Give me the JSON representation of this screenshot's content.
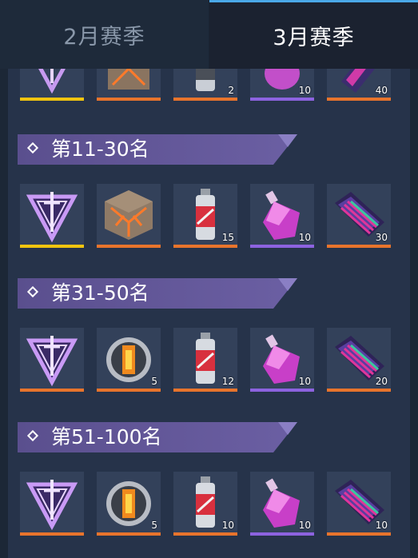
{
  "tabs": [
    {
      "label": "2月赛季",
      "active": false
    },
    {
      "label": "3月赛季",
      "active": true
    }
  ],
  "top_row_counts": [
    "2",
    "10",
    "40"
  ],
  "groups": [
    {
      "title": "第11-30名",
      "items": [
        {
          "icon": "emblem-icon",
          "count": "",
          "bar": "yellow"
        },
        {
          "icon": "crate-icon",
          "count": "",
          "bar": "orange"
        },
        {
          "icon": "spray-can-icon",
          "count": "15",
          "bar": "orange"
        },
        {
          "icon": "crystal-bottle-icon",
          "count": "10",
          "bar": "purple"
        },
        {
          "icon": "gem-card-icon",
          "count": "30",
          "bar": "orange"
        }
      ]
    },
    {
      "title": "第31-50名",
      "items": [
        {
          "icon": "emblem-icon",
          "count": "",
          "bar": "orange"
        },
        {
          "icon": "orb-icon",
          "count": "5",
          "bar": "orange"
        },
        {
          "icon": "spray-can-icon",
          "count": "12",
          "bar": "orange"
        },
        {
          "icon": "crystal-bottle-icon",
          "count": "10",
          "bar": "purple"
        },
        {
          "icon": "gem-card-icon",
          "count": "20",
          "bar": "orange"
        }
      ]
    },
    {
      "title": "第51-100名",
      "items": [
        {
          "icon": "emblem-icon",
          "count": "",
          "bar": "orange"
        },
        {
          "icon": "orb-icon",
          "count": "5",
          "bar": "orange"
        },
        {
          "icon": "spray-can-icon",
          "count": "10",
          "bar": "orange"
        },
        {
          "icon": "crystal-bottle-icon",
          "count": "10",
          "bar": "purple"
        },
        {
          "icon": "gem-card-icon",
          "count": "10",
          "bar": "orange"
        }
      ]
    }
  ]
}
